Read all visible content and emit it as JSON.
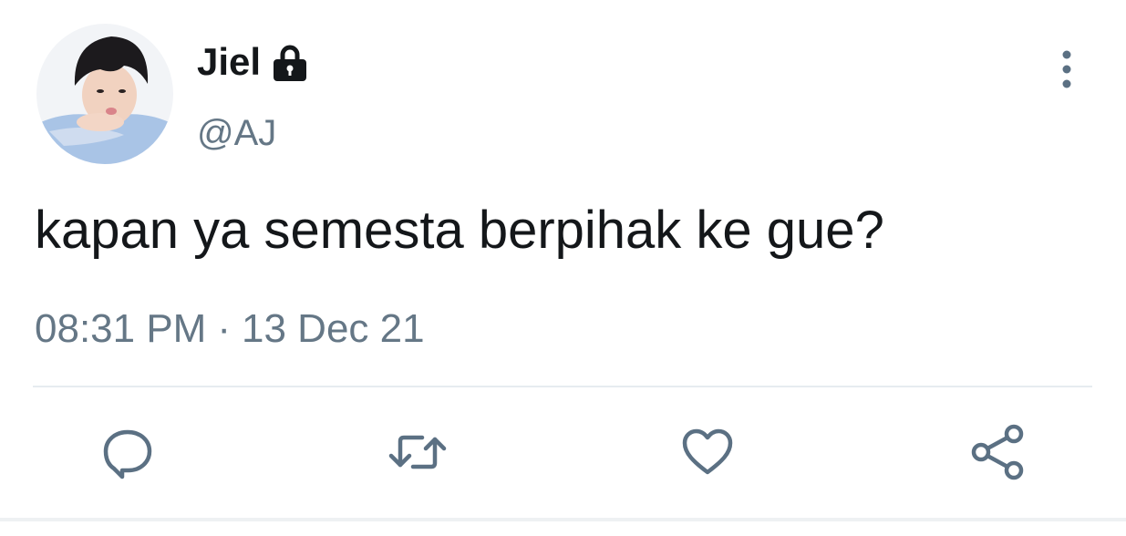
{
  "user": {
    "display_name": "Jiel",
    "handle": "@AJ",
    "protected_icon": "lock-icon",
    "avatar_icon": "avatar"
  },
  "tweet": {
    "text": "kapan ya semesta berpihak ke gue?",
    "time": "08:31 PM",
    "separator": "·",
    "date": "13 Dec 21"
  },
  "actions": [
    {
      "icon": "reply-icon"
    },
    {
      "icon": "retweet-icon"
    },
    {
      "icon": "like-icon"
    },
    {
      "icon": "share-icon"
    }
  ],
  "menu": {
    "icon": "more-options-icon"
  },
  "colors": {
    "primary_text": "#14171a",
    "secondary_text": "#657786",
    "icon": "#5b7083",
    "divider": "#e6ecf0"
  }
}
